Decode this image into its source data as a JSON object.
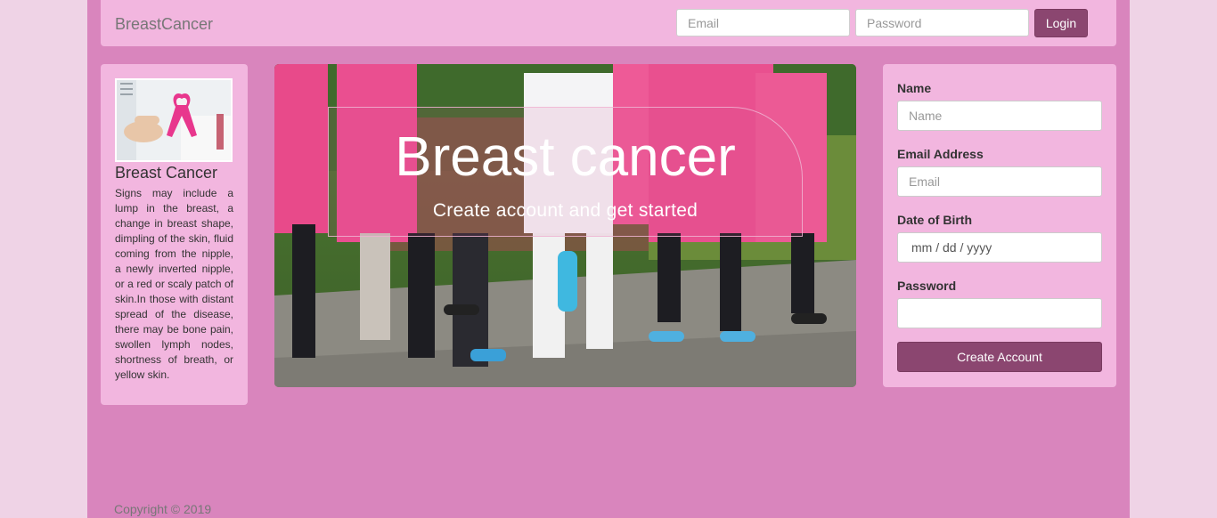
{
  "navbar": {
    "brand": "BreastCancer",
    "email_placeholder": "Email",
    "password_placeholder": "Password",
    "login_label": "Login"
  },
  "info_card": {
    "title": "Breast Cancer",
    "text": "Signs may include a lump in the breast, a change in breast shape, dimpling of the skin, fluid coming from the nipple, a newly inverted nipple, or a red or scaly patch of skin.In those with distant spread of the disease, there may be bone pain, swollen lymph nodes, shortness of breath, or yellow skin."
  },
  "hero": {
    "title": "Breast cancer",
    "subtitle": "Create account and get started"
  },
  "signup_form": {
    "name_label": "Name",
    "name_placeholder": "Name",
    "email_label": "Email Address",
    "email_placeholder": "Email",
    "dob_label": "Date of Birth",
    "dob_placeholder": "mm / dd / yyyy",
    "password_label": "Password",
    "submit_label": "Create Account"
  },
  "footer": {
    "copyright": "Copyright © 2019"
  },
  "colors": {
    "page_bg": "#efd3e6",
    "container_bg": "#d985bd",
    "card_bg": "#f2b6df",
    "button_bg": "#8b4670"
  }
}
